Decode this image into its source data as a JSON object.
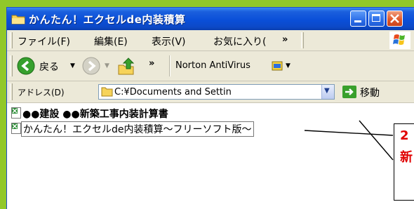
{
  "window": {
    "title": "かんたん！エクセルde内装積算"
  },
  "menubar": {
    "items": [
      "ファイル(F)",
      "編集(E)",
      "表示(V)",
      "お気に入り(",
      "»"
    ]
  },
  "toolbar": {
    "back_label": "戻る",
    "chevron": "»",
    "norton_label": "Norton AntiVirus"
  },
  "addressbar": {
    "label": "アドレス(D)",
    "path": "C:¥Documents and Settin",
    "go_label": "移動"
  },
  "files": [
    {
      "name": "●●建設  ●●新築工事内装計算書"
    },
    {
      "name": "かんたん！エクセルde内装積算～フリーソフト版～"
    }
  ],
  "callout": {
    "line1": "2",
    "line2": "新"
  },
  "colors": {
    "background": "#91c82a",
    "titlebar": "#0a4fd8",
    "callout_text": "#e00000"
  }
}
